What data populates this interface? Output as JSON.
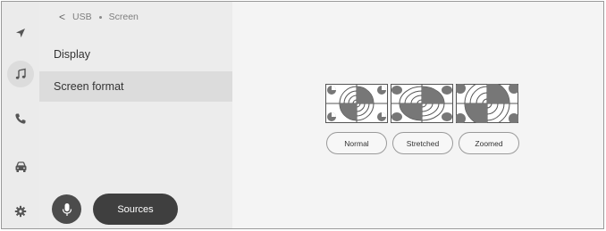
{
  "rail": {
    "icons": [
      "navigation-icon",
      "music-icon",
      "phone-icon",
      "car-icon",
      "settings-icon"
    ],
    "active": "music-icon"
  },
  "breadcrumb": {
    "back_glyph": "<",
    "parent": "USB",
    "current": "Screen"
  },
  "menu": {
    "items": [
      {
        "label": "Display",
        "selected": false
      },
      {
        "label": "Screen format",
        "selected": true
      }
    ]
  },
  "footer": {
    "sources_label": "Sources"
  },
  "screen_format": {
    "options": [
      {
        "label": "Normal",
        "selected": false
      },
      {
        "label": "Stretched",
        "selected": false
      },
      {
        "label": "Zoomed",
        "selected": false
      }
    ]
  },
  "colors": {
    "rail_bg": "#ebebeb",
    "panel_bg": "#ececec",
    "selected_row": "#dcdcdc",
    "content_bg": "#f4f4f4",
    "dark_button": "#3f3f3f"
  }
}
